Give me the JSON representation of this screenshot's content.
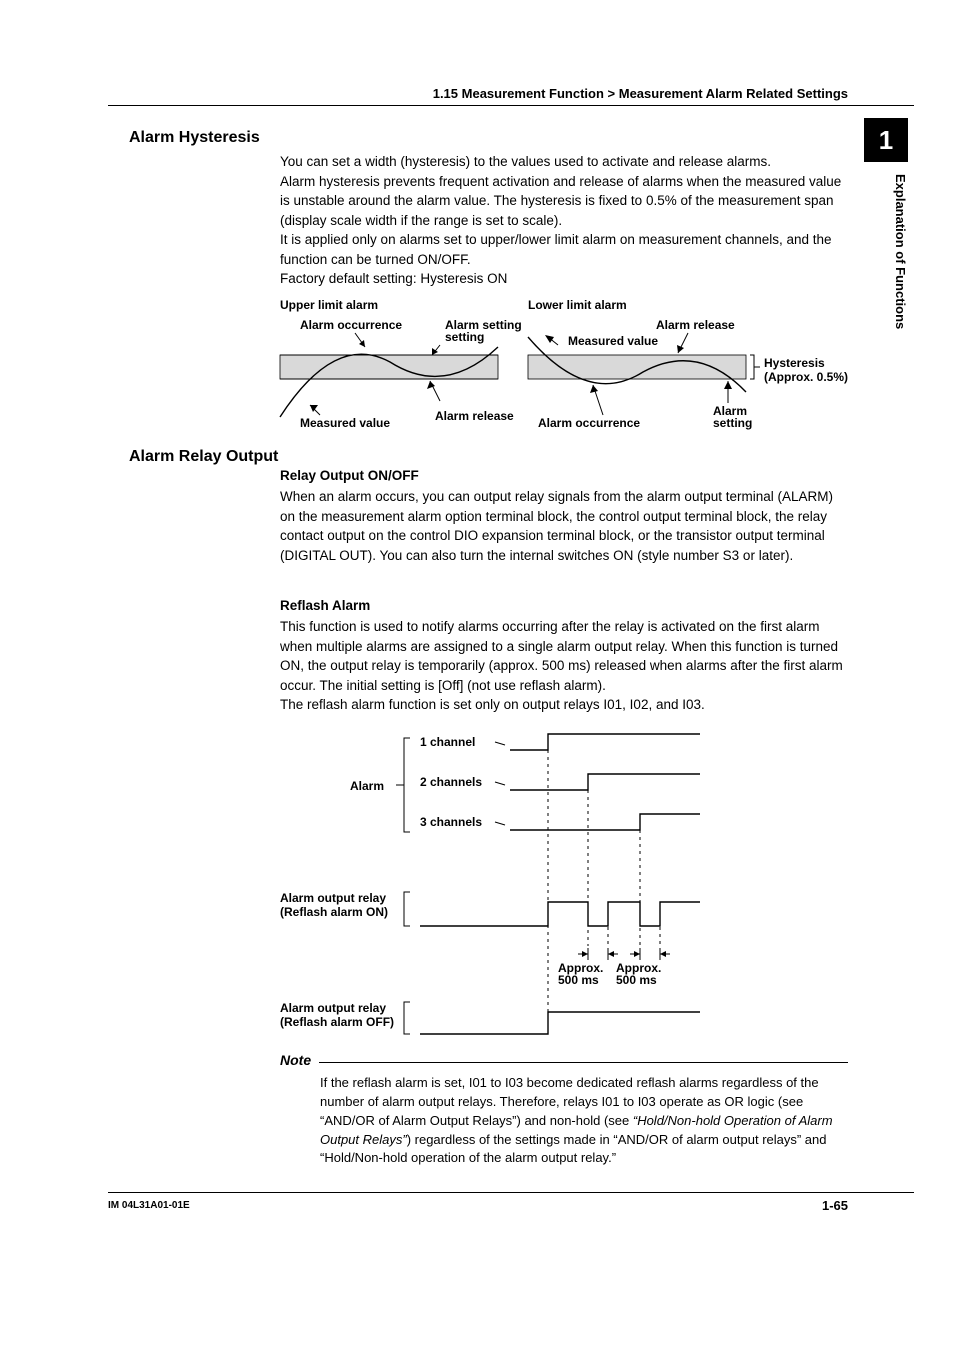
{
  "breadcrumb": "1.15  Measurement Function > Measurement Alarm Related Settings",
  "side_tab_number": "1",
  "side_tab_label": "Explanation of Functions",
  "section_hysteresis": {
    "title": "Alarm Hysteresis",
    "p1": "You can set a width (hysteresis) to the values used to activate and release alarms.",
    "p2": "Alarm hysteresis prevents frequent activation and release of alarms when the measured value is unstable around the alarm value.  The hysteresis is fixed to 0.5% of the measurement span (display scale width if the range is set to scale).",
    "p3": "It is applied only on alarms set to upper/lower limit alarm on measurement channels, and the function can be turned ON/OFF.",
    "p4": "Factory default setting: Hysteresis ON"
  },
  "diagram1": {
    "upper_title": "Upper limit alarm",
    "lower_title": "Lower limit alarm",
    "alarm_occurrence": "Alarm occurrence",
    "alarm_setting": "Alarm setting",
    "measured_value": "Measured value",
    "alarm_release": "Alarm release",
    "hysteresis": "Hysteresis",
    "hysteresis_val": "(Approx. 0.5%)"
  },
  "section_relay": {
    "title": "Alarm Relay Output",
    "relay_heading": "Relay Output ON/OFF",
    "relay_body": "When an alarm occurs, you can output relay signals from the alarm output terminal (ALARM) on the measurement alarm option terminal block, the control output terminal block, the relay contact output on the control DIO expansion terminal block, or the transistor output terminal (DIGITAL OUT).  You can also turn the internal switches ON (style number S3 or later).",
    "reflash_heading": "Reflash Alarm",
    "reflash_body": "This function is used to notify alarms occurring after the relay is activated on the first alarm when multiple alarms are assigned to a single alarm output relay.  When this function is turned ON, the output relay is temporarily (approx. 500 ms) released when alarms after the first alarm occur.  The initial setting is [Off] (not use reflash alarm).",
    "reflash_body2": "The reflash alarm function is set only on output relays I01, I02, and I03."
  },
  "diagram2": {
    "alarm": "Alarm",
    "ch1": "1 channel",
    "ch2": "2 channels",
    "ch3": "3 channels",
    "out_on": "Alarm output relay",
    "out_on2": "(Reflash alarm ON)",
    "out_off": "Alarm output relay",
    "out_off2": "(Reflash alarm OFF)",
    "approx": "Approx.",
    "ms": "500 ms"
  },
  "note": {
    "label": "Note",
    "body_a": "If the reflash alarm is set, I01 to I03 become dedicated reflash alarms regardless of the number of alarm output relays.  Therefore, relays I01 to I03 operate as OR logic (see “AND/OR of Alarm Output Relays”) and non-hold (see ",
    "body_italic": "“Hold/Non-hold Operation of Alarm Output Relays”",
    "body_b": ") regardless of the settings made in “AND/OR of alarm output relays” and “Hold/Non-hold operation of the alarm output relay.”"
  },
  "footer_left": "IM 04L31A01-01E",
  "footer_right": "1-65"
}
